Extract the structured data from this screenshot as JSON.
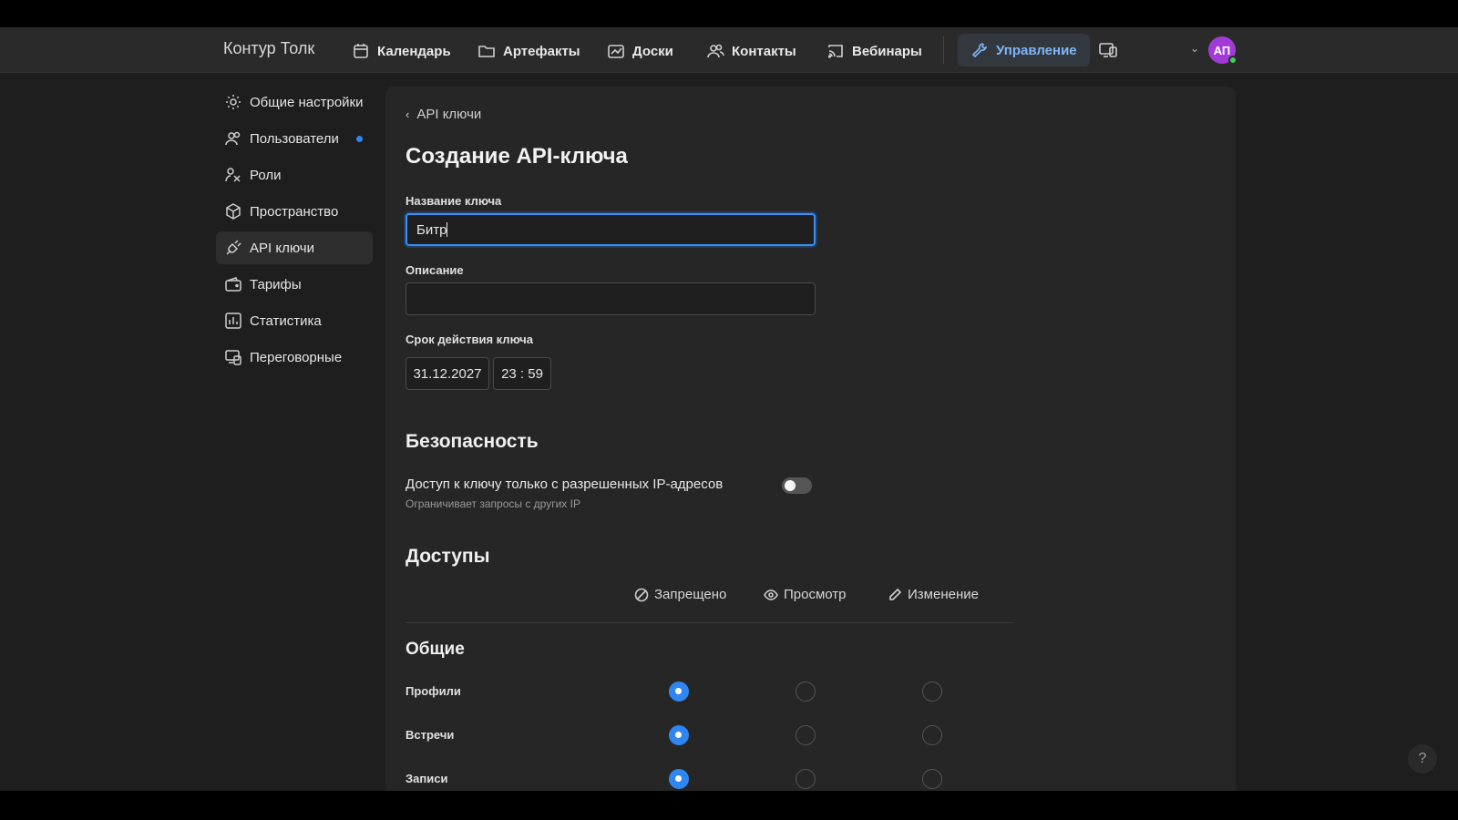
{
  "header": {
    "brand": "Контур Толк",
    "nav": [
      {
        "label": "Календарь",
        "icon": "calendar-icon"
      },
      {
        "label": "Артефакты",
        "icon": "folder-icon"
      },
      {
        "label": "Доски",
        "icon": "board-icon"
      },
      {
        "label": "Контакты",
        "icon": "contacts-icon"
      },
      {
        "label": "Вебинары",
        "icon": "cast-icon"
      },
      {
        "label": "Управление",
        "icon": "wrench-icon",
        "active": true
      }
    ],
    "avatar_initials": "АП",
    "avatar_color": "#a23bd6",
    "online_color": "#3fd05a"
  },
  "sidebar": {
    "items": [
      {
        "label": "Общие настройки",
        "icon": "gear-icon"
      },
      {
        "label": "Пользователи",
        "icon": "users-icon",
        "has_indicator": true
      },
      {
        "label": "Роли",
        "icon": "roles-icon"
      },
      {
        "label": "Пространство",
        "icon": "cube-icon"
      },
      {
        "label": "API ключи",
        "icon": "plug-icon",
        "active": true
      },
      {
        "label": "Тарифы",
        "icon": "wallet-icon"
      },
      {
        "label": "Статистика",
        "icon": "stats-icon"
      },
      {
        "label": "Переговорные",
        "icon": "rooms-icon"
      }
    ]
  },
  "form": {
    "breadcrumb": "API ключи",
    "title": "Создание API-ключа",
    "name_label": "Название ключа",
    "name_value": "Битр",
    "description_label": "Описание",
    "description_value": "",
    "expiry_label": "Срок действия ключа",
    "expiry_date": "31.12.2027",
    "expiry_time": "23 : 59"
  },
  "security": {
    "heading": "Безопасность",
    "ip_title": "Доступ к ключу только с разрешенных IP-адресов",
    "ip_subtitle": "Ограничивает запросы с других IP",
    "ip_enabled": false
  },
  "access": {
    "heading": "Доступы",
    "columns": [
      "Запрещено",
      "Просмотр",
      "Изменение"
    ],
    "group_heading": "Общие",
    "rows": [
      {
        "label": "Профили",
        "selected": 0
      },
      {
        "label": "Встречи",
        "selected": 0
      },
      {
        "label": "Записи",
        "selected": 0
      }
    ]
  },
  "help_label": "?",
  "accent_color": "#2f86f0"
}
